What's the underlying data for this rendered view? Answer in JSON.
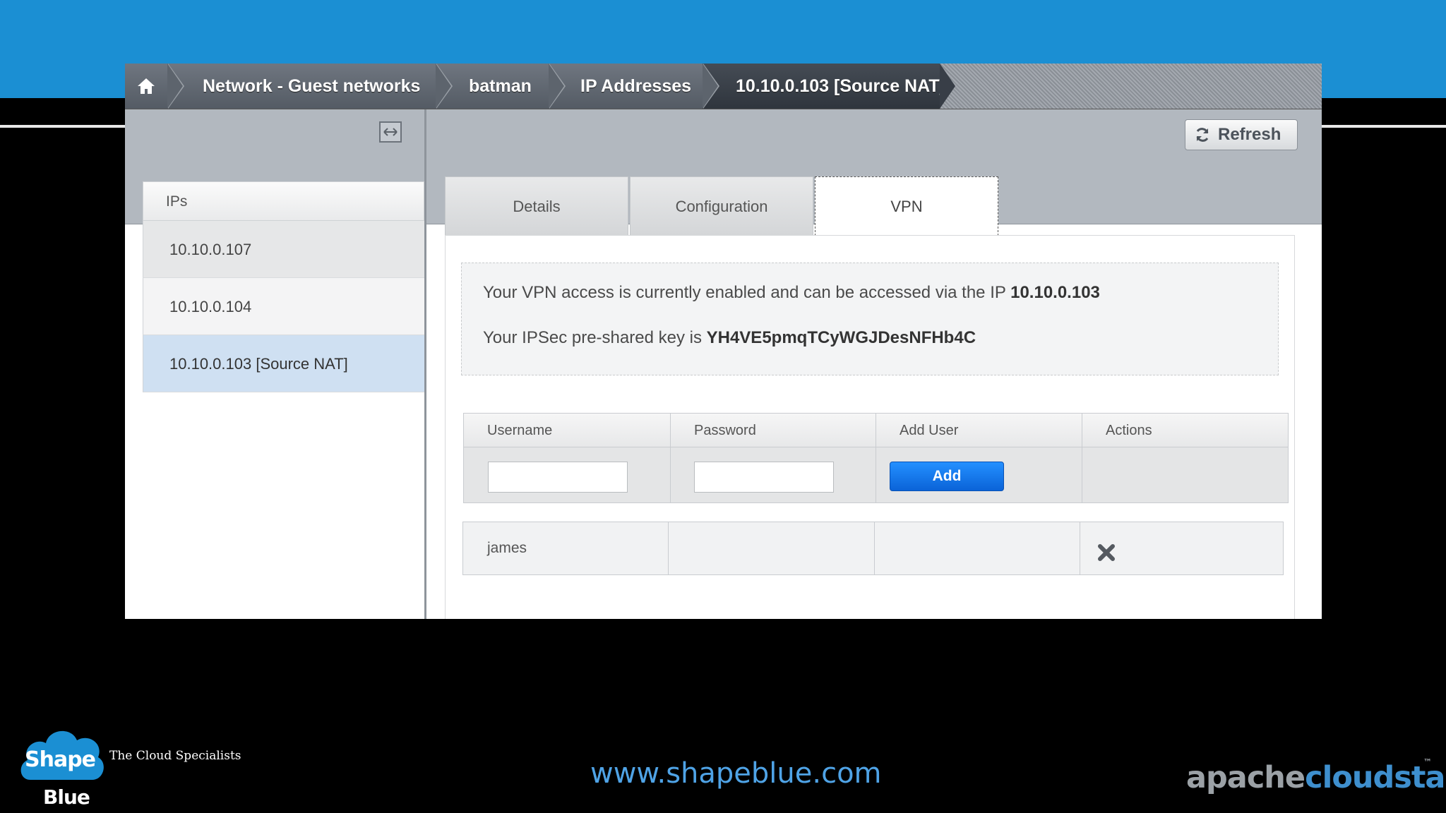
{
  "breadcrumb": {
    "home_icon": "home-icon",
    "items": [
      "Network - Guest networks",
      "batman",
      "IP Addresses",
      "10.10.0.103 [Source NAT]"
    ]
  },
  "toolbar": {
    "collapse_icon": "collapse-panel-icon",
    "refresh_label": "Refresh",
    "refresh_icon": "refresh-icon"
  },
  "sidebar": {
    "header": "IPs",
    "items": [
      "10.10.0.107",
      "10.10.0.104",
      "10.10.0.103 [Source NAT]"
    ],
    "selected": "10.10.0.103 [Source NAT]"
  },
  "tabs": {
    "items": [
      "Details",
      "Configuration",
      "VPN"
    ],
    "active": "VPN"
  },
  "vpn": {
    "line1_prefix": "Your VPN access is currently enabled and can be accessed via the IP ",
    "ip": "10.10.0.103",
    "line2_prefix": "Your IPSec pre-shared key is ",
    "psk": "YH4VE5pmqTCyWGJDesNFHb4C",
    "table": {
      "columns": [
        "Username",
        "Password",
        "Add User",
        "Actions"
      ],
      "add_label": "Add",
      "username_value": "",
      "password_value": ""
    },
    "users": [
      {
        "username": "james",
        "action_icon": "delete-icon"
      }
    ]
  },
  "footer": {
    "logo_top": "Shape",
    "logo_bottom": "Blue",
    "tagline": "The Cloud Specialists",
    "website": "www.shapeblue.com",
    "brand_part1": "apache",
    "brand_part2": "cloudstack",
    "brand_tm": "™"
  },
  "colors": {
    "top_band": "#1b8fd3",
    "add_button": "#0a63d8",
    "selected_row": "#cfe0f2",
    "website": "#4fa3e6",
    "brand_cloudstack": "#3e8fce"
  }
}
